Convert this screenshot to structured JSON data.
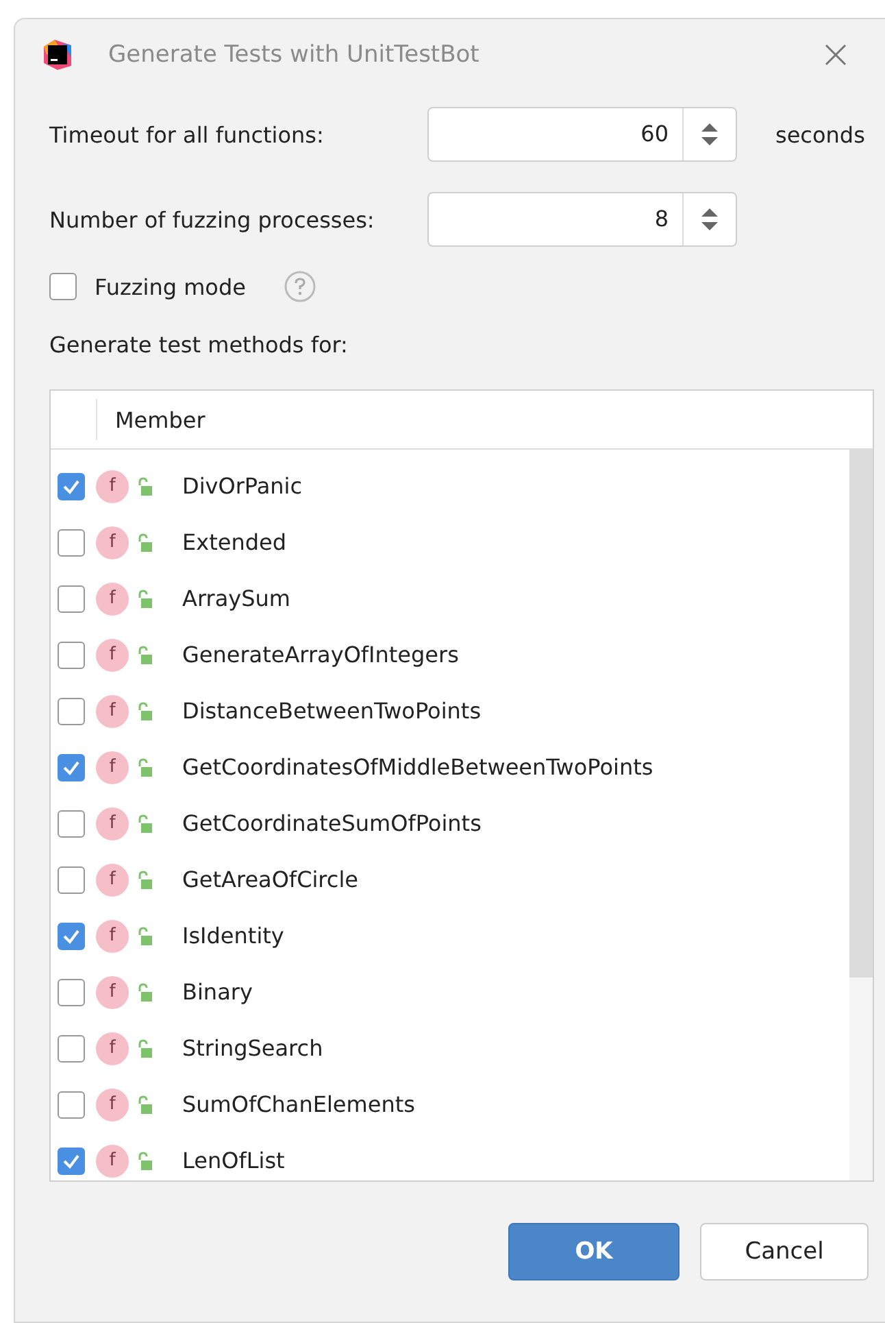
{
  "window": {
    "title": "Generate Tests with UnitTestBot"
  },
  "timeout": {
    "label": "Timeout for all functions:",
    "value": "60",
    "unit": "seconds"
  },
  "processes": {
    "label": "Number of fuzzing processes:",
    "value": "8"
  },
  "fuzzing_mode": {
    "label": "Fuzzing mode",
    "checked": false
  },
  "methods_label": "Generate test methods for:",
  "table": {
    "columns": [
      "Member"
    ],
    "rows": [
      {
        "name": "DivOrPanic",
        "badge": "f",
        "checked": true
      },
      {
        "name": "Extended",
        "badge": "f",
        "checked": false
      },
      {
        "name": "ArraySum",
        "badge": "f",
        "checked": false
      },
      {
        "name": "GenerateArrayOfIntegers",
        "badge": "f",
        "checked": false
      },
      {
        "name": "DistanceBetweenTwoPoints",
        "badge": "f",
        "checked": false
      },
      {
        "name": "GetCoordinatesOfMiddleBetweenTwoPoints",
        "badge": "f",
        "checked": true
      },
      {
        "name": "GetCoordinateSumOfPoints",
        "badge": "f",
        "checked": false
      },
      {
        "name": "GetAreaOfCircle",
        "badge": "f",
        "checked": false
      },
      {
        "name": "IsIdentity",
        "badge": "f",
        "checked": true
      },
      {
        "name": "Binary",
        "badge": "f",
        "checked": false
      },
      {
        "name": "StringSearch",
        "badge": "f",
        "checked": false
      },
      {
        "name": "SumOfChanElements",
        "badge": "f",
        "checked": false
      },
      {
        "name": "LenOfList",
        "badge": "f",
        "checked": true
      }
    ]
  },
  "buttons": [
    "OK",
    "Cancel"
  ]
}
